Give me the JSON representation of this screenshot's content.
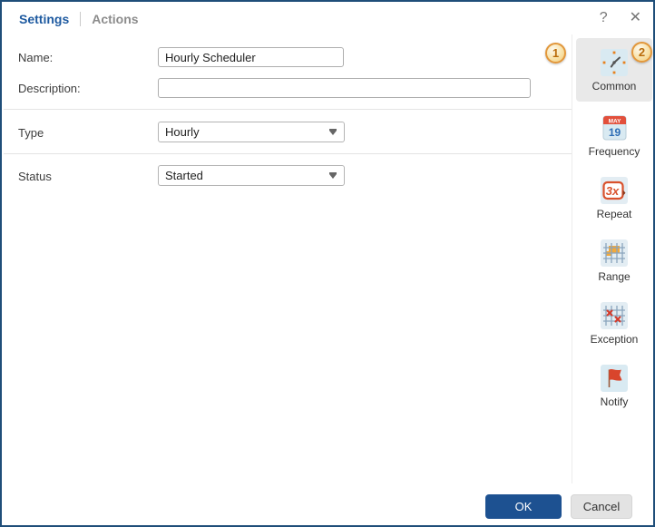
{
  "header": {
    "tabs": [
      {
        "label": "Settings",
        "active": true
      },
      {
        "label": "Actions",
        "active": false
      }
    ],
    "help_icon": "?",
    "close_icon": "✕"
  },
  "form": {
    "name_label": "Name:",
    "name_value": "Hourly Scheduler",
    "description_label": "Description:",
    "description_value": "",
    "type_label": "Type",
    "type_value": "Hourly",
    "status_label": "Status",
    "status_value": "Started"
  },
  "badges": {
    "step1": "1",
    "step2": "2"
  },
  "sidebar": {
    "items": [
      {
        "label": "Common",
        "icon": "clock-icon",
        "selected": true
      },
      {
        "label": "Frequency",
        "icon": "calendar-icon",
        "selected": false
      },
      {
        "label": "Repeat",
        "icon": "repeat-3x-icon",
        "selected": false
      },
      {
        "label": "Range",
        "icon": "grid-range-icon",
        "selected": false
      },
      {
        "label": "Exception",
        "icon": "grid-exception-icon",
        "selected": false
      },
      {
        "label": "Notify",
        "icon": "flag-icon",
        "selected": false
      }
    ],
    "frequency_calendar": {
      "month": "MAY",
      "day": "19"
    },
    "repeat_text": "3x"
  },
  "footer": {
    "ok": "OK",
    "cancel": "Cancel"
  },
  "colors": {
    "window_border": "#1f4e79",
    "tab_active": "#1e5aa0",
    "ok_button": "#1d5191",
    "badge_orange": "#e2973b",
    "selected_tile": "#e9e9e9",
    "icon_red": "#d9512c",
    "icon_blue_bg": "#d9eaf2"
  }
}
